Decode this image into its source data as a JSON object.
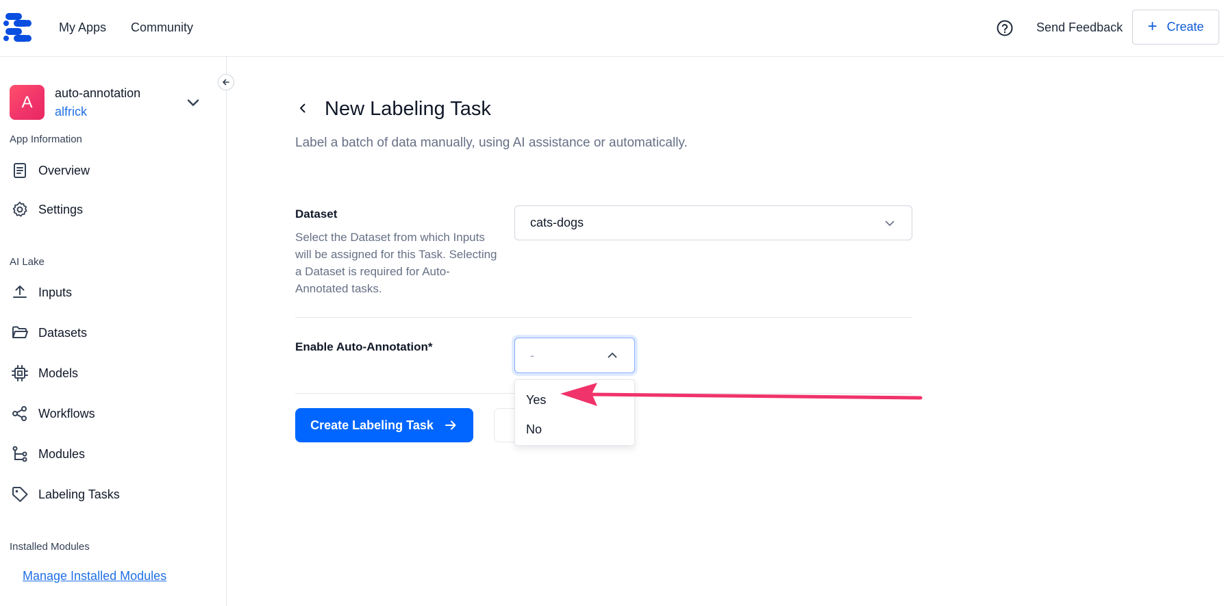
{
  "topnav": {
    "my_apps": "My Apps",
    "community": "Community",
    "send_feedback": "Send Feedback",
    "create_label": "Create",
    "help_icon": "help-circle-icon"
  },
  "sidebar": {
    "app": {
      "avatar_letter": "A",
      "name": "auto-annotation",
      "user": "alfrick"
    },
    "sections": {
      "app_information": "App Information",
      "ai_lake": "AI Lake",
      "installed_modules": "Installed Modules"
    },
    "items": [
      {
        "label": "Overview",
        "icon": "document-icon"
      },
      {
        "label": "Settings",
        "icon": "gear-icon"
      },
      {
        "label": "Inputs",
        "icon": "upload-icon"
      },
      {
        "label": "Datasets",
        "icon": "folder-icon"
      },
      {
        "label": "Models",
        "icon": "chip-icon"
      },
      {
        "label": "Workflows",
        "icon": "share-icon"
      },
      {
        "label": "Modules",
        "icon": "tree-icon"
      },
      {
        "label": "Labeling Tasks",
        "icon": "tag-icon"
      }
    ],
    "manage_link": "Manage Installed Modules"
  },
  "main": {
    "title": "New Labeling Task",
    "subtitle": "Label a batch of data manually, using AI assistance or automatically.",
    "dataset": {
      "label": "Dataset",
      "description": "Select the Dataset from which Inputs will be assigned for this Task. Selecting a Dataset is required for Auto-Annotated tasks.",
      "value": "cats-dogs"
    },
    "auto_annotation": {
      "label": "Enable Auto-Annotation*",
      "value": "-",
      "options": [
        "Yes",
        "No"
      ]
    },
    "create_button": "Create Labeling Task"
  },
  "colors": {
    "primary": "#0066ff",
    "link": "#1f6fe5",
    "annotation_arrow": "#f0336a"
  }
}
